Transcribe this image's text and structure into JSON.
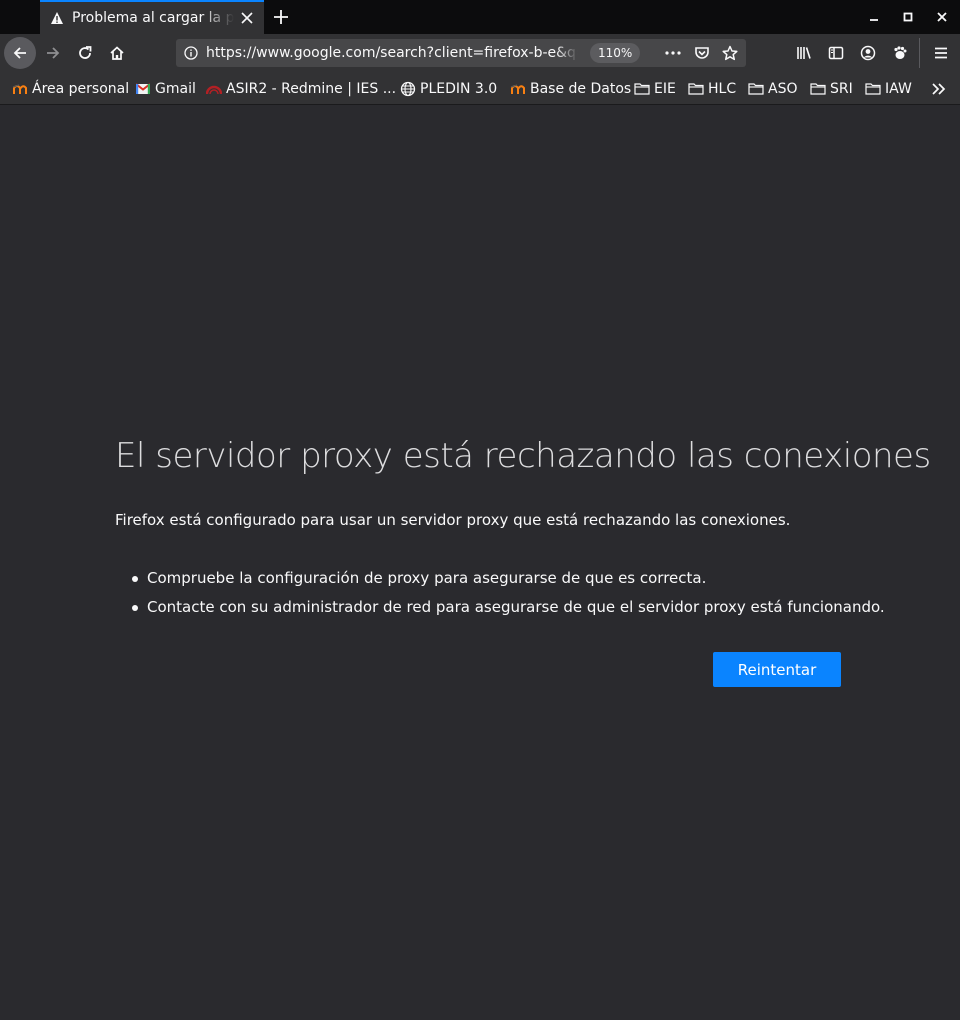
{
  "tab": {
    "title": "Problema al cargar la página",
    "icon": "warning-icon"
  },
  "navbar": {
    "url": "https://www.google.com/search?client=firefox-b-e&q=",
    "zoom": "110%"
  },
  "bookmarks": [
    {
      "label": "Área personal",
      "icon": "moodle-icon"
    },
    {
      "label": "Gmail",
      "icon": "gmail-icon"
    },
    {
      "label": "ASIR2 - Redmine | IES ...",
      "icon": "redmine-icon"
    },
    {
      "label": "PLEDIN 3.0",
      "icon": "globe-icon"
    },
    {
      "label": "Base de Datos",
      "icon": "moodle-icon"
    },
    {
      "label": "EIE",
      "icon": "folder-icon"
    },
    {
      "label": "HLC",
      "icon": "folder-icon"
    },
    {
      "label": "ASO",
      "icon": "folder-icon"
    },
    {
      "label": "SRI",
      "icon": "folder-icon"
    },
    {
      "label": "IAW",
      "icon": "folder-icon"
    }
  ],
  "error": {
    "title": "El servidor proxy está rechazando las conexiones",
    "description": "Firefox está configurado para usar un servidor proxy que está rechazando las conexiones.",
    "tips": [
      "Compruebe la configuración de proxy para asegurarse de que es correcta.",
      "Contacte con su administrador de red para asegurarse de que el servidor proxy está funcionando."
    ],
    "retry_label": "Reintentar"
  },
  "colors": {
    "page_bg": "#2a2a2e",
    "toolbar_bg": "#323234",
    "accent": "#0a84ff"
  }
}
